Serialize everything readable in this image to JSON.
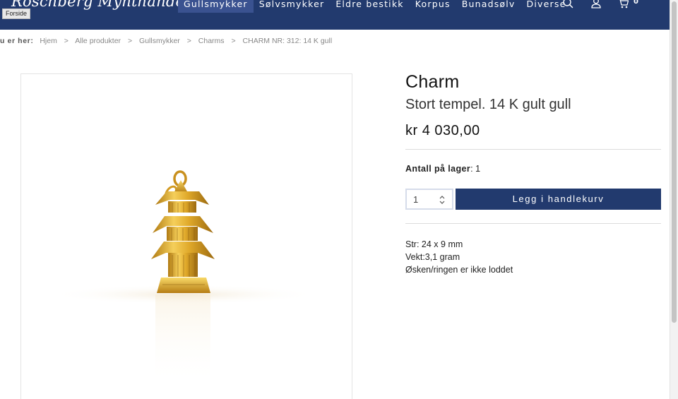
{
  "header": {
    "logo": "Roschberg Mynthandel AS",
    "forside_tooltip": "Forside",
    "nav": [
      "Gullsmykker",
      "Sølvsmykker",
      "Eldre bestikk",
      "Korpus",
      "Bunadsølv",
      "Diverse"
    ],
    "active_nav": "Gullsmykker",
    "icons": [
      "search-icon",
      "user-icon",
      "cart-icon"
    ],
    "cart_count": "0"
  },
  "breadcrumb": {
    "label": "u er her:",
    "items": [
      "Hjem",
      "Alle produkter",
      "Gullsmykker",
      "Charms",
      "CHARM NR: 312: 14 K gull"
    ],
    "separator": ">"
  },
  "product": {
    "title": "Charm",
    "subtitle": "Stort tempel. 14 K gult gull",
    "price": "kr 4 030,00",
    "stock_label": "Antall på lager",
    "stock_value": ": 1",
    "quantity": "1",
    "add_to_cart": "Legg i handlekurv",
    "description": [
      "Str: 24 x 9 mm",
      "Vekt:3,1 gram",
      "Øsken/ringen er ikke loddet"
    ]
  },
  "colors": {
    "brand": "#223a6e",
    "nav_active": "#3a5290",
    "gold": "#d9a520"
  }
}
